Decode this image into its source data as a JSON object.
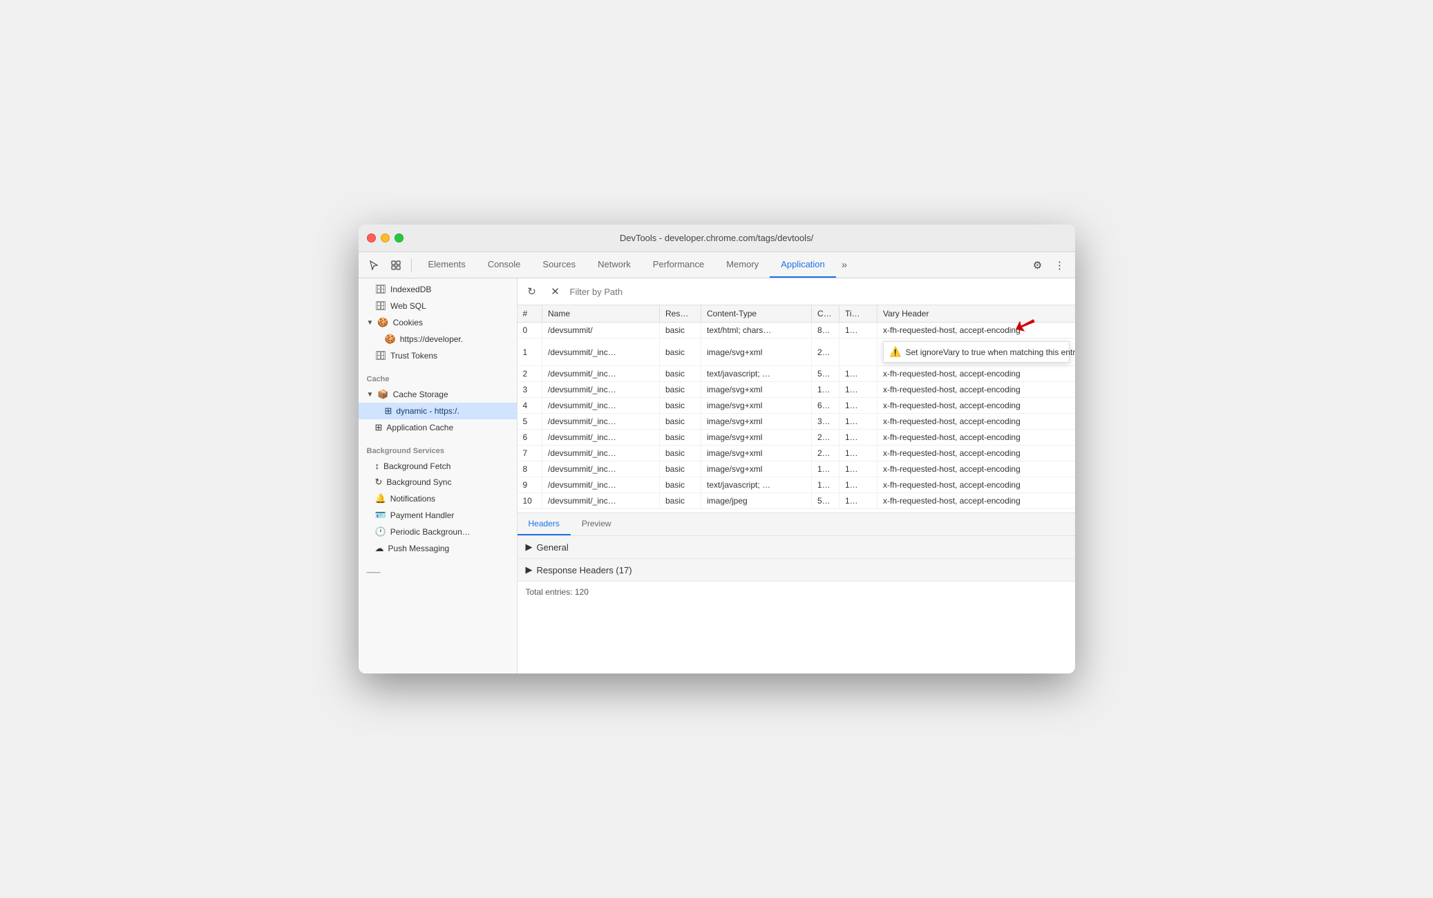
{
  "window": {
    "title": "DevTools - developer.chrome.com/tags/devtools/"
  },
  "toolbar": {
    "tabs": [
      "Elements",
      "Console",
      "Sources",
      "Network",
      "Performance",
      "Memory",
      "Application"
    ],
    "active_tab": "Application"
  },
  "sidebar": {
    "items": [
      {
        "id": "indexeddb",
        "label": "IndexedDB",
        "icon": "🗄️",
        "indent": 1,
        "type": "db"
      },
      {
        "id": "websql",
        "label": "Web SQL",
        "icon": "🗄️",
        "indent": 1,
        "type": "db"
      },
      {
        "id": "cookies-header",
        "label": "▼  Cookies",
        "icon": "🍪",
        "indent": 0,
        "type": "header"
      },
      {
        "id": "cookies-https",
        "label": "https://developer.",
        "icon": "🍪",
        "indent": 2,
        "type": "item"
      },
      {
        "id": "trust-tokens",
        "label": "Trust Tokens",
        "icon": "🗄️",
        "indent": 1,
        "type": "item"
      },
      {
        "id": "cache-section",
        "label": "Cache",
        "type": "section"
      },
      {
        "id": "cache-storage",
        "label": "▼  Cache Storage",
        "icon": "📦",
        "indent": 0,
        "type": "header"
      },
      {
        "id": "dynamic-cache",
        "label": "dynamic - https:/.",
        "icon": "⊞",
        "indent": 2,
        "type": "item",
        "selected": true
      },
      {
        "id": "app-cache",
        "label": "Application Cache",
        "icon": "⊞",
        "indent": 1,
        "type": "item"
      },
      {
        "id": "bg-section",
        "label": "Background Services",
        "type": "section"
      },
      {
        "id": "bg-fetch",
        "label": "Background Fetch",
        "icon": "↕",
        "indent": 1,
        "type": "item"
      },
      {
        "id": "bg-sync",
        "label": "Background Sync",
        "icon": "↻",
        "indent": 1,
        "type": "item"
      },
      {
        "id": "notifications",
        "label": "Notifications",
        "icon": "🔔",
        "indent": 1,
        "type": "item"
      },
      {
        "id": "payment-handler",
        "label": "Payment Handler",
        "icon": "🪪",
        "indent": 1,
        "type": "item"
      },
      {
        "id": "periodic-bg",
        "label": "Periodic Backgroun…",
        "icon": "🕐",
        "indent": 1,
        "type": "item"
      },
      {
        "id": "push-messaging",
        "label": "Push Messaging",
        "icon": "☁",
        "indent": 1,
        "type": "item"
      }
    ]
  },
  "filter": {
    "placeholder": "Filter by Path",
    "value": ""
  },
  "table": {
    "columns": [
      "#",
      "Name",
      "Res…",
      "Content-Type",
      "C…",
      "Ti…",
      "Vary Header"
    ],
    "rows": [
      {
        "num": "0",
        "name": "/devsummit/",
        "res": "basic",
        "ct": "text/html; chars…",
        "c": "8…",
        "ti": "1…",
        "vary": "x-fh-requested-host, accept-encoding",
        "selected": false
      },
      {
        "num": "1",
        "name": "/devsummit/_inc…",
        "res": "basic",
        "ct": "image/svg+xml",
        "c": "2…",
        "ti": "",
        "vary": "",
        "tooltip": true,
        "selected": false
      },
      {
        "num": "2",
        "name": "/devsummit/_inc…",
        "res": "basic",
        "ct": "text/javascript; …",
        "c": "5…",
        "ti": "1…",
        "vary": "x-fh-requested-host, accept-encoding",
        "selected": false
      },
      {
        "num": "3",
        "name": "/devsummit/_inc…",
        "res": "basic",
        "ct": "image/svg+xml",
        "c": "1…",
        "ti": "1…",
        "vary": "x-fh-requested-host, accept-encoding",
        "selected": false
      },
      {
        "num": "4",
        "name": "/devsummit/_inc…",
        "res": "basic",
        "ct": "image/svg+xml",
        "c": "6…",
        "ti": "1…",
        "vary": "x-fh-requested-host, accept-encoding",
        "selected": false
      },
      {
        "num": "5",
        "name": "/devsummit/_inc…",
        "res": "basic",
        "ct": "image/svg+xml",
        "c": "3…",
        "ti": "1…",
        "vary": "x-fh-requested-host, accept-encoding",
        "selected": false
      },
      {
        "num": "6",
        "name": "/devsummit/_inc…",
        "res": "basic",
        "ct": "image/svg+xml",
        "c": "2…",
        "ti": "1…",
        "vary": "x-fh-requested-host, accept-encoding",
        "selected": false
      },
      {
        "num": "7",
        "name": "/devsummit/_inc…",
        "res": "basic",
        "ct": "image/svg+xml",
        "c": "2…",
        "ti": "1…",
        "vary": "x-fh-requested-host, accept-encoding",
        "selected": false
      },
      {
        "num": "8",
        "name": "/devsummit/_inc…",
        "res": "basic",
        "ct": "image/svg+xml",
        "c": "1…",
        "ti": "1…",
        "vary": "x-fh-requested-host, accept-encoding",
        "selected": false
      },
      {
        "num": "9",
        "name": "/devsummit/_inc…",
        "res": "basic",
        "ct": "text/javascript; …",
        "c": "1…",
        "ti": "1…",
        "vary": "x-fh-requested-host, accept-encoding",
        "selected": false
      },
      {
        "num": "10",
        "name": "/devsummit/_inc…",
        "res": "basic",
        "ct": "image/jpeg",
        "c": "5…",
        "ti": "1…",
        "vary": "x-fh-requested-host, accept-encoding",
        "selected": false
      }
    ],
    "tooltip_text": "Set ignoreVary to true when matching this entry"
  },
  "bottom": {
    "tabs": [
      "Headers",
      "Preview"
    ],
    "active_tab": "Headers",
    "sections": [
      {
        "id": "general",
        "label": "General",
        "expanded": false
      },
      {
        "id": "response-headers",
        "label": "Response Headers (17)",
        "expanded": false
      }
    ],
    "total_entries": "Total entries: 120"
  }
}
